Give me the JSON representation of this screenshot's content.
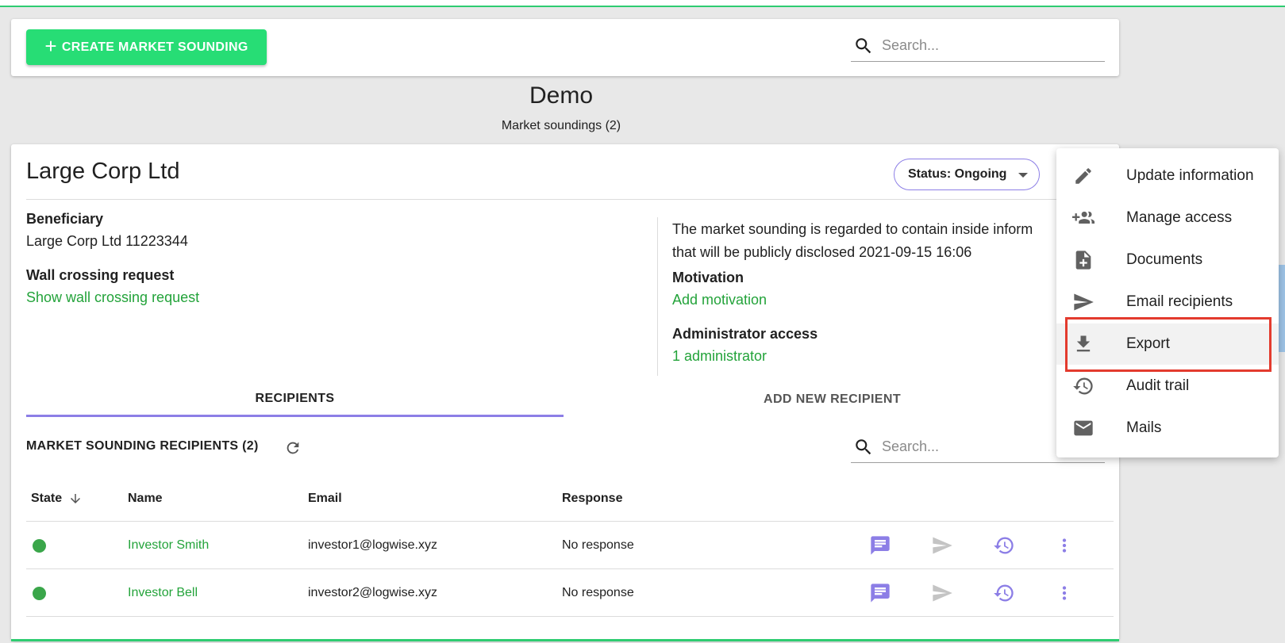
{
  "header": {
    "create_button_label": "CREATE MARKET SOUNDING",
    "search_placeholder": "Search..."
  },
  "page": {
    "title": "Demo",
    "subtitle": "Market soundings (2)"
  },
  "sounding": {
    "company": "Large Corp Ltd",
    "status_label": "Status: Ongoing",
    "beneficiary_label": "Beneficiary",
    "beneficiary_value": "Large Corp Ltd 11223344",
    "wall_crossing_label": "Wall crossing request",
    "wall_crossing_link": "Show wall crossing request",
    "inside_info_line1": "The market sounding is regarded to contain inside inform",
    "inside_info_line2": "that will be publicly disclosed 2021-09-15 16:06",
    "motivation_label": "Motivation",
    "motivation_link": "Add motivation",
    "admin_label": "Administrator access",
    "admin_link": "1 administrator"
  },
  "tabs": {
    "recipients": "RECIPIENTS",
    "add_new": "ADD NEW RECIPIENT"
  },
  "recipients": {
    "title": "MARKET SOUNDING RECIPIENTS (2)",
    "search_placeholder": "Search...",
    "columns": {
      "state": "State",
      "name": "Name",
      "email": "Email",
      "response": "Response"
    },
    "rows": [
      {
        "name": "Investor Smith",
        "email": "investor1@logwise.xyz",
        "response": "No response",
        "state_color": "#3aa64a"
      },
      {
        "name": "Investor Bell",
        "email": "investor2@logwise.xyz",
        "response": "No response",
        "state_color": "#3aa64a"
      }
    ]
  },
  "menu": {
    "items": [
      {
        "label": "Update information",
        "icon": "pencil-icon"
      },
      {
        "label": "Manage access",
        "icon": "group-add-icon"
      },
      {
        "label": "Documents",
        "icon": "note-add-icon"
      },
      {
        "label": "Email recipients",
        "icon": "send-icon"
      },
      {
        "label": "Export",
        "icon": "download-icon",
        "highlighted": true
      },
      {
        "label": "Audit trail",
        "icon": "history-icon"
      },
      {
        "label": "Mails",
        "icon": "mail-icon"
      }
    ]
  },
  "colors": {
    "accent_green": "#27dd75",
    "link_green": "#23a33a",
    "accent_purple": "#8c7ee6",
    "highlight_red": "#e33b2e"
  }
}
